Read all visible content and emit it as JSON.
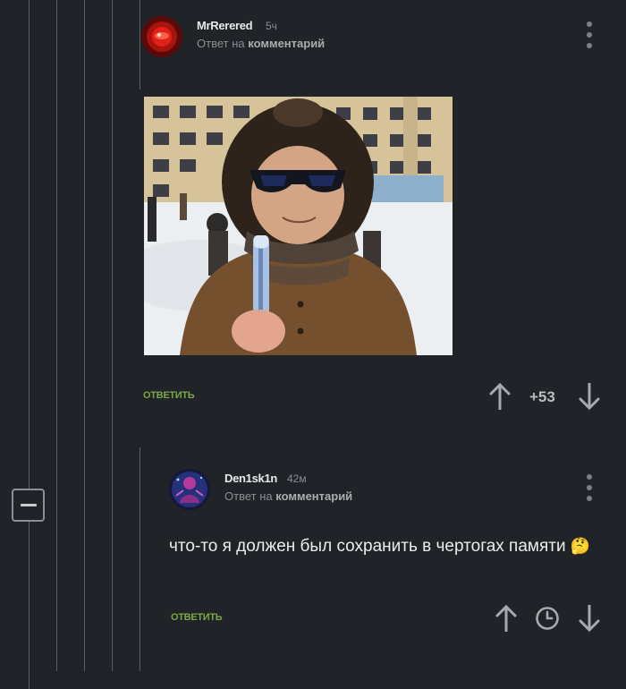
{
  "comments": [
    {
      "username": "MrRerered",
      "time": "5ч",
      "reply_prefix": "Ответ на",
      "reply_target": "комментарий",
      "reply_label": "ОТВЕТИТЬ",
      "rating": "+53",
      "image": {
        "subject": "child-in-winter-hat-sunglasses",
        "colors": {
          "building": "#d9c69c",
          "snow": "#eef0f2",
          "coat": "#7a5233",
          "hat": "#2e241c"
        }
      }
    },
    {
      "username": "Den1sk1n",
      "time": "42м",
      "reply_prefix": "Ответ на",
      "reply_target": "комментарий",
      "text": "что-то я должен был сохранить в чертогах памяти",
      "emoji": "🤔",
      "reply_label": "ОТВЕТИТЬ"
    }
  ],
  "icons": {
    "upvote": "arrow-up-icon",
    "downvote": "arrow-down-icon",
    "save": "clock-icon",
    "menu": "more-vertical-icon",
    "collapse": "minus-icon"
  },
  "colors": {
    "background": "#202327",
    "reply_button": "#7aa845",
    "thread_line": "#5a5e63",
    "muted_text": "#8a8e93"
  }
}
